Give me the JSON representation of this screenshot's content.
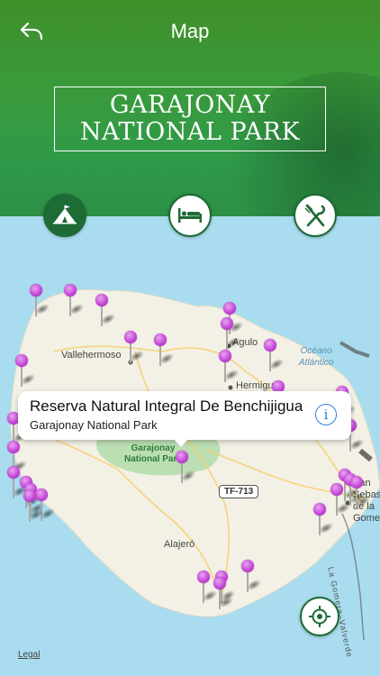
{
  "header": {
    "title": "Map",
    "park_name_line1": "GARAJONAY",
    "park_name_line2": "NATIONAL PARK"
  },
  "icons": {
    "back": "back-arrow-icon",
    "camp": "tent-icon",
    "hotel": "bed-icon",
    "food": "fork-knife-icon",
    "locate": "crosshair-icon",
    "info": "info-icon"
  },
  "colors": {
    "header_green": "#3a9a3a",
    "active_green": "#1d6b35",
    "pin_purple": "#c243d6",
    "sea": "#a9dcef",
    "land": "#f3f1e6",
    "park_green": "#b6dcad",
    "info_blue": "#2f7fd8"
  },
  "map": {
    "places": [
      "Vallehermoso",
      "Agulo",
      "Hermigua",
      "Alajeró",
      "San Sebastián de la Gomera"
    ],
    "ocean_label_line1": "Océano",
    "ocean_label_line2": "Atlántico",
    "park_label_line1": "Garajonay",
    "park_label_line2": "National Park",
    "road_badge": "TF-713",
    "coast_road": "La Gomera–Valverde",
    "legal": "Legal"
  },
  "callout": {
    "title": "Reserva Natural Integral De Benchijigua",
    "subtitle": "Garajonay National Park",
    "info_glyph": "i"
  }
}
